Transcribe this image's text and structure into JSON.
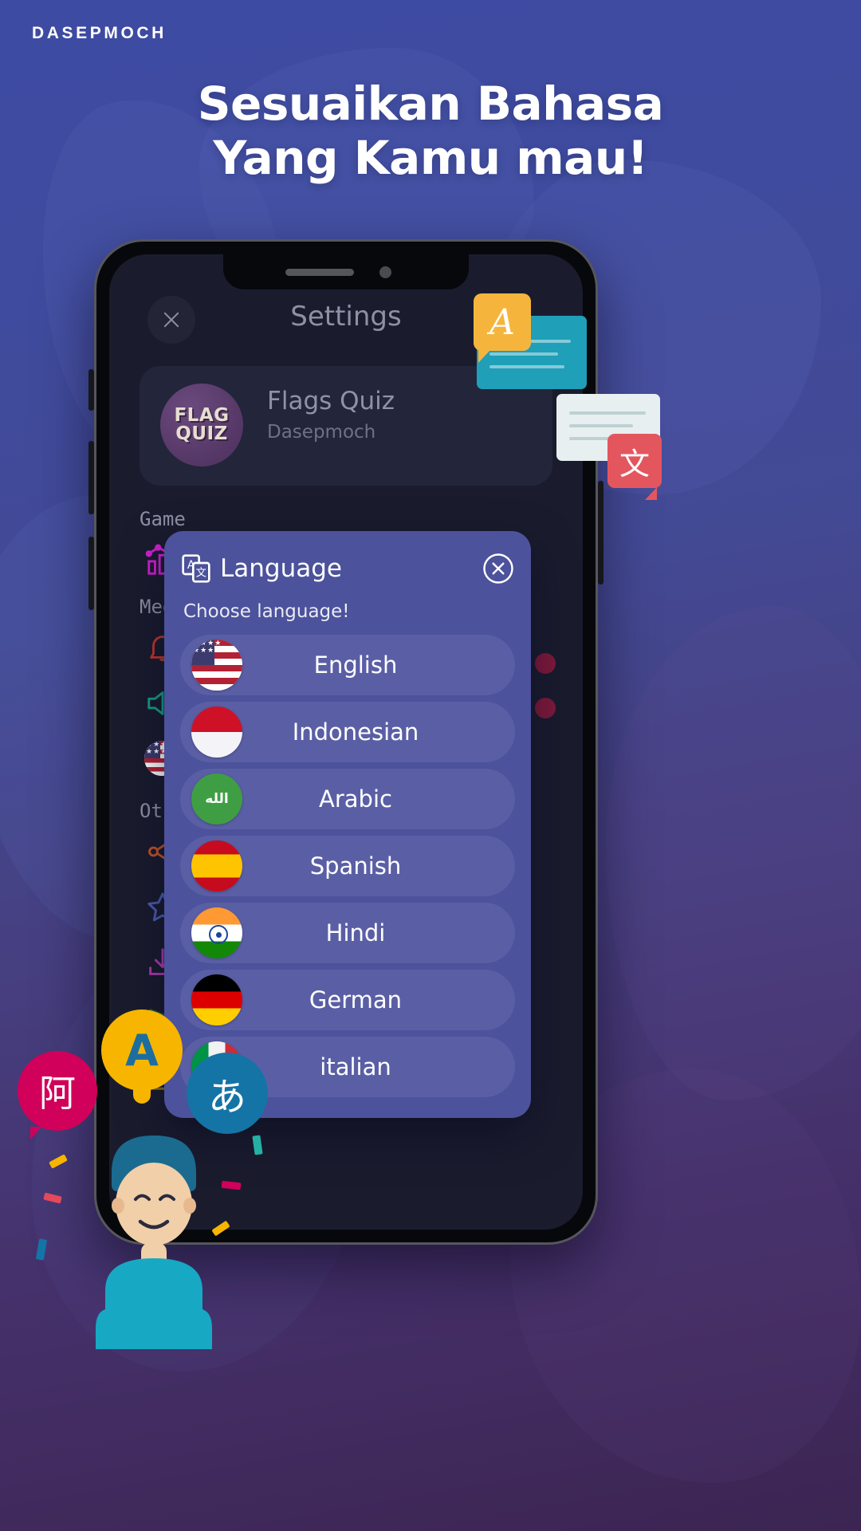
{
  "brand": "DASEPMOCH",
  "headline": {
    "line1": "Sesuaikan Bahasa",
    "line2": "Yang Kamu mau!"
  },
  "phone_app": {
    "title": "Settings",
    "close_icon": "close-icon",
    "app_card": {
      "icon_line1": "FLAG",
      "icon_line2": "QUIZ",
      "name": "Flags Quiz",
      "developer": "Dasepmoch"
    },
    "sections": [
      {
        "label": "Game",
        "items": [
          {
            "icon": "chart-icon"
          }
        ]
      },
      {
        "label": "Media",
        "items": [
          {
            "icon": "bell-icon"
          },
          {
            "icon": "speaker-icon"
          },
          {
            "icon": "flag-us-icon"
          }
        ]
      },
      {
        "label": "Other",
        "items": [
          {
            "icon": "share-icon"
          },
          {
            "icon": "star-icon"
          },
          {
            "icon": "download-icon"
          },
          {
            "icon": "send-icon"
          },
          {
            "icon": "lock-icon"
          }
        ]
      }
    ]
  },
  "modal": {
    "icon": "translate-icon",
    "title": "Language",
    "close_icon": "close-circle-icon",
    "subtitle": "Choose language!",
    "languages": [
      {
        "name": "English",
        "flag": "flag-us",
        "flag_name": "united-states-flag-icon"
      },
      {
        "name": "Indonesian",
        "flag": "flag-id",
        "flag_name": "indonesia-flag-icon"
      },
      {
        "name": "Arabic",
        "flag": "flag-sa",
        "flag_name": "saudi-arabia-flag-icon"
      },
      {
        "name": "Spanish",
        "flag": "flag-es",
        "flag_name": "spain-flag-icon"
      },
      {
        "name": "Hindi",
        "flag": "flag-in",
        "flag_name": "india-flag-icon"
      },
      {
        "name": "German",
        "flag": "flag-de",
        "flag_name": "germany-flag-icon"
      },
      {
        "name": "italian",
        "flag": "flag-it",
        "flag_name": "italy-flag-icon"
      }
    ]
  },
  "decor": {
    "bubble_latin": "A",
    "bubble_cjk": "文",
    "pin_chinese": "阿",
    "pin_latin": "A",
    "pin_japanese": "あ",
    "arabic_flag_text": "الله"
  },
  "colors": {
    "modal_bg": "#4c529b",
    "row_bg": "#5a5fa5",
    "screen_bg": "#1a1c2e",
    "accent_yellow": "#f7b500",
    "accent_pink": "#d1005a",
    "accent_blue": "#1474a6"
  }
}
